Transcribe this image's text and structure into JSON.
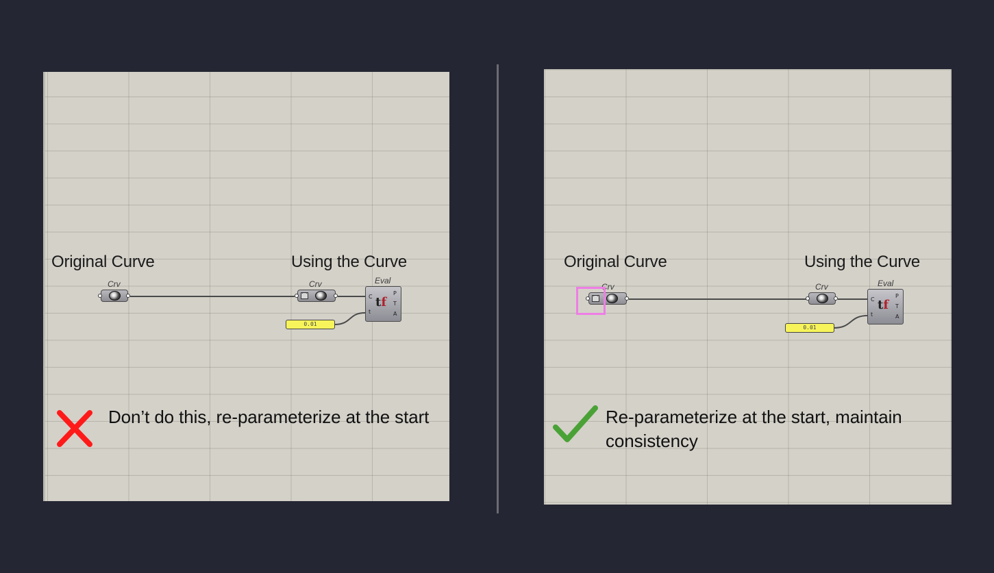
{
  "left": {
    "original_label": "Original Curve",
    "using_label": "Using the Curve",
    "crv_label_1": "Crv",
    "crv_label_2": "Crv",
    "eval_title": "Eval",
    "eval_inputs": [
      "C",
      "t"
    ],
    "eval_outputs": [
      "P",
      "T",
      "A"
    ],
    "slider_value": "0.01",
    "caption": "Don’t do this, re-parameterize at the start",
    "mark_icon": "cross-icon",
    "mark_color": "#ff1a1a"
  },
  "right": {
    "original_label": "Original Curve",
    "using_label": "Using the Curve",
    "crv_label_1": "Crv",
    "crv_label_2": "Crv",
    "eval_title": "Eval",
    "eval_inputs": [
      "C",
      "t"
    ],
    "eval_outputs": [
      "P",
      "T",
      "A"
    ],
    "slider_value": "0.01",
    "caption": "Re-parameterize at the start, maintain consistency",
    "mark_icon": "check-icon",
    "mark_color": "#4aa236",
    "highlight_color": "#ee7ee5"
  }
}
